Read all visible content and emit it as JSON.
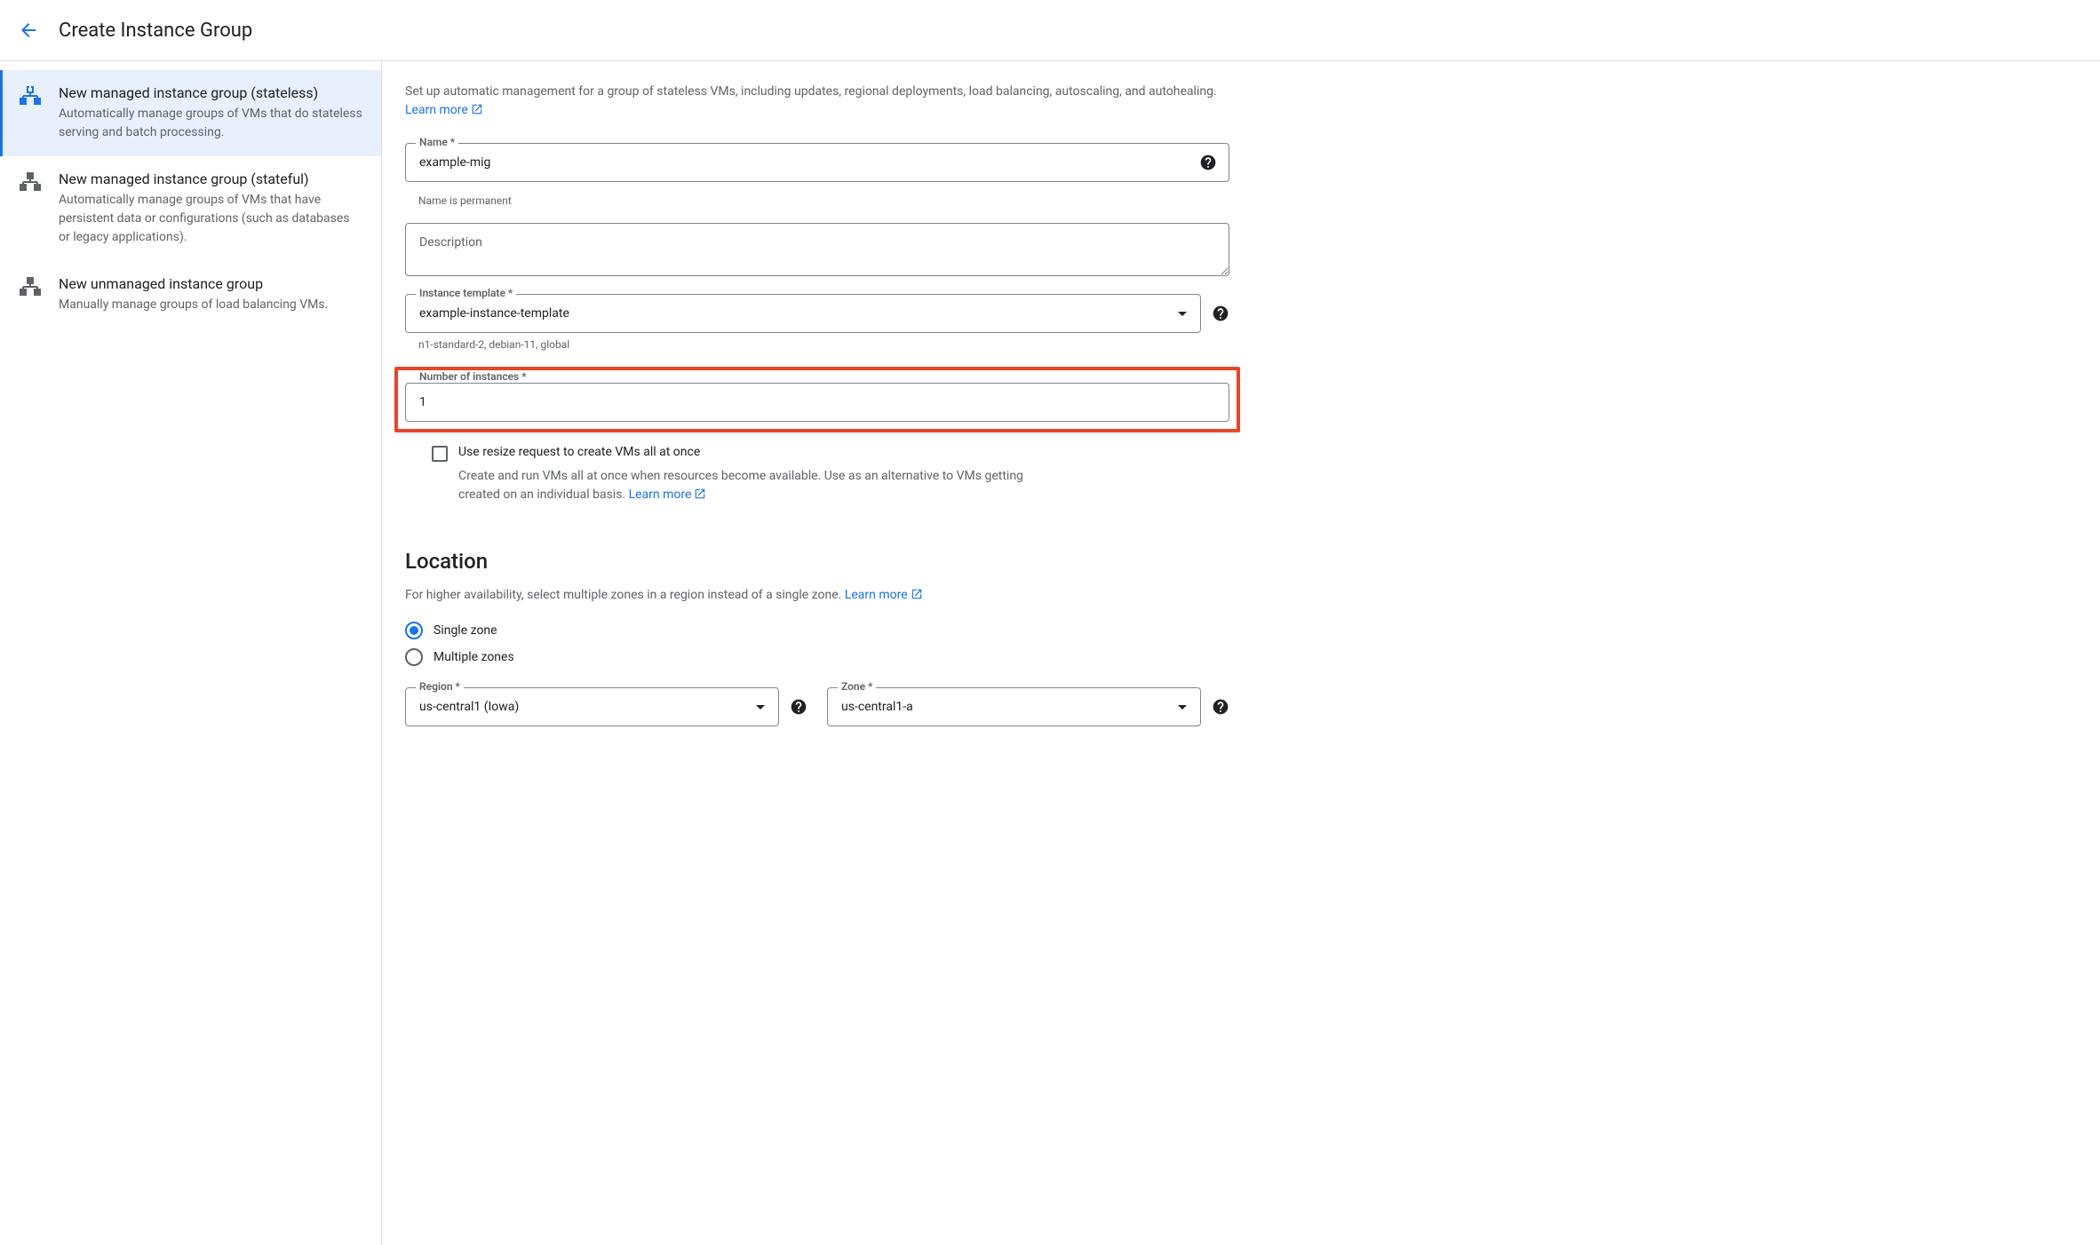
{
  "header": {
    "title": "Create Instance Group"
  },
  "sidebar": {
    "items": [
      {
        "title": "New managed instance group (stateless)",
        "desc": "Automatically manage groups of VMs that do stateless serving and batch processing."
      },
      {
        "title": "New managed instance group (stateful)",
        "desc": "Automatically manage groups of VMs that have persistent data or configurations (such as databases or legacy applications)."
      },
      {
        "title": "New unmanaged instance group",
        "desc": "Manually manage groups of load balancing VMs."
      }
    ]
  },
  "main": {
    "intro": "Set up automatic management for a group of stateless VMs, including updates, regional deployments, load balancing, autoscaling, and autohealing. ",
    "learn_more": "Learn more",
    "name": {
      "label": "Name *",
      "value": "example-mig",
      "helper": "Name is permanent"
    },
    "description": {
      "placeholder": "Description"
    },
    "instance_template": {
      "label": "Instance template *",
      "value": "example-instance-template",
      "helper": "n1-standard-2, debian-11, global"
    },
    "num_instances": {
      "label": "Number of instances *",
      "value": "1"
    },
    "resize_request": {
      "label": "Use resize request to create VMs all at once",
      "desc": "Create and run VMs all at once when resources become available. Use as an alternative to VMs getting created on an individual basis. "
    },
    "location": {
      "title": "Location",
      "desc": "For higher availability, select multiple zones in a region instead of a single zone. ",
      "single_zone": "Single zone",
      "multiple_zones": "Multiple zones",
      "region": {
        "label": "Region *",
        "value": "us-central1 (Iowa)"
      },
      "zone": {
        "label": "Zone *",
        "value": "us-central1-a"
      }
    }
  }
}
